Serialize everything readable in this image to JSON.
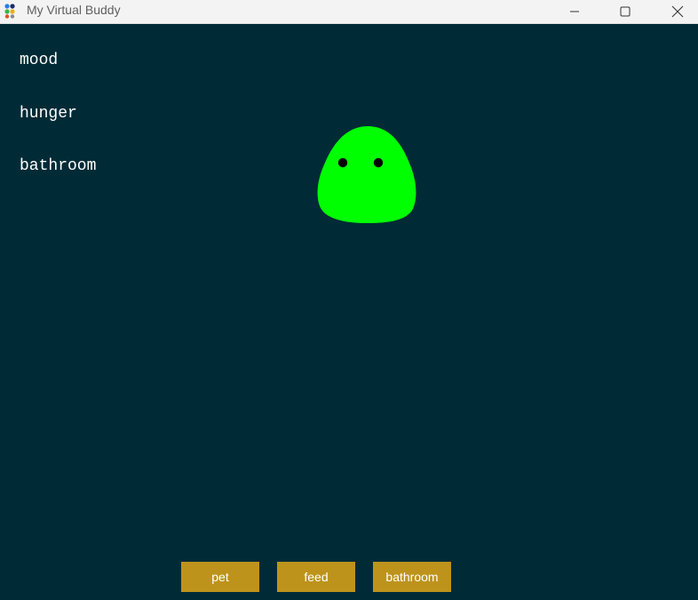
{
  "window": {
    "title": "My Virtual Buddy",
    "app_icon": "colored-dots-icon",
    "controls": {
      "minimize_icon": "minimize-icon",
      "maximize_icon": "maximize-icon",
      "close_icon": "close-icon"
    }
  },
  "stats": {
    "mood_label": "mood",
    "hunger_label": "hunger",
    "bathroom_label": "bathroom"
  },
  "pet": {
    "body_color": "#00ff00",
    "eye_color": "#000000"
  },
  "actions": {
    "pet_label": "pet",
    "feed_label": "feed",
    "bathroom_label": "bathroom"
  },
  "colors": {
    "background": "#002b36",
    "button": "#bd931b",
    "text": "#ffffff"
  }
}
